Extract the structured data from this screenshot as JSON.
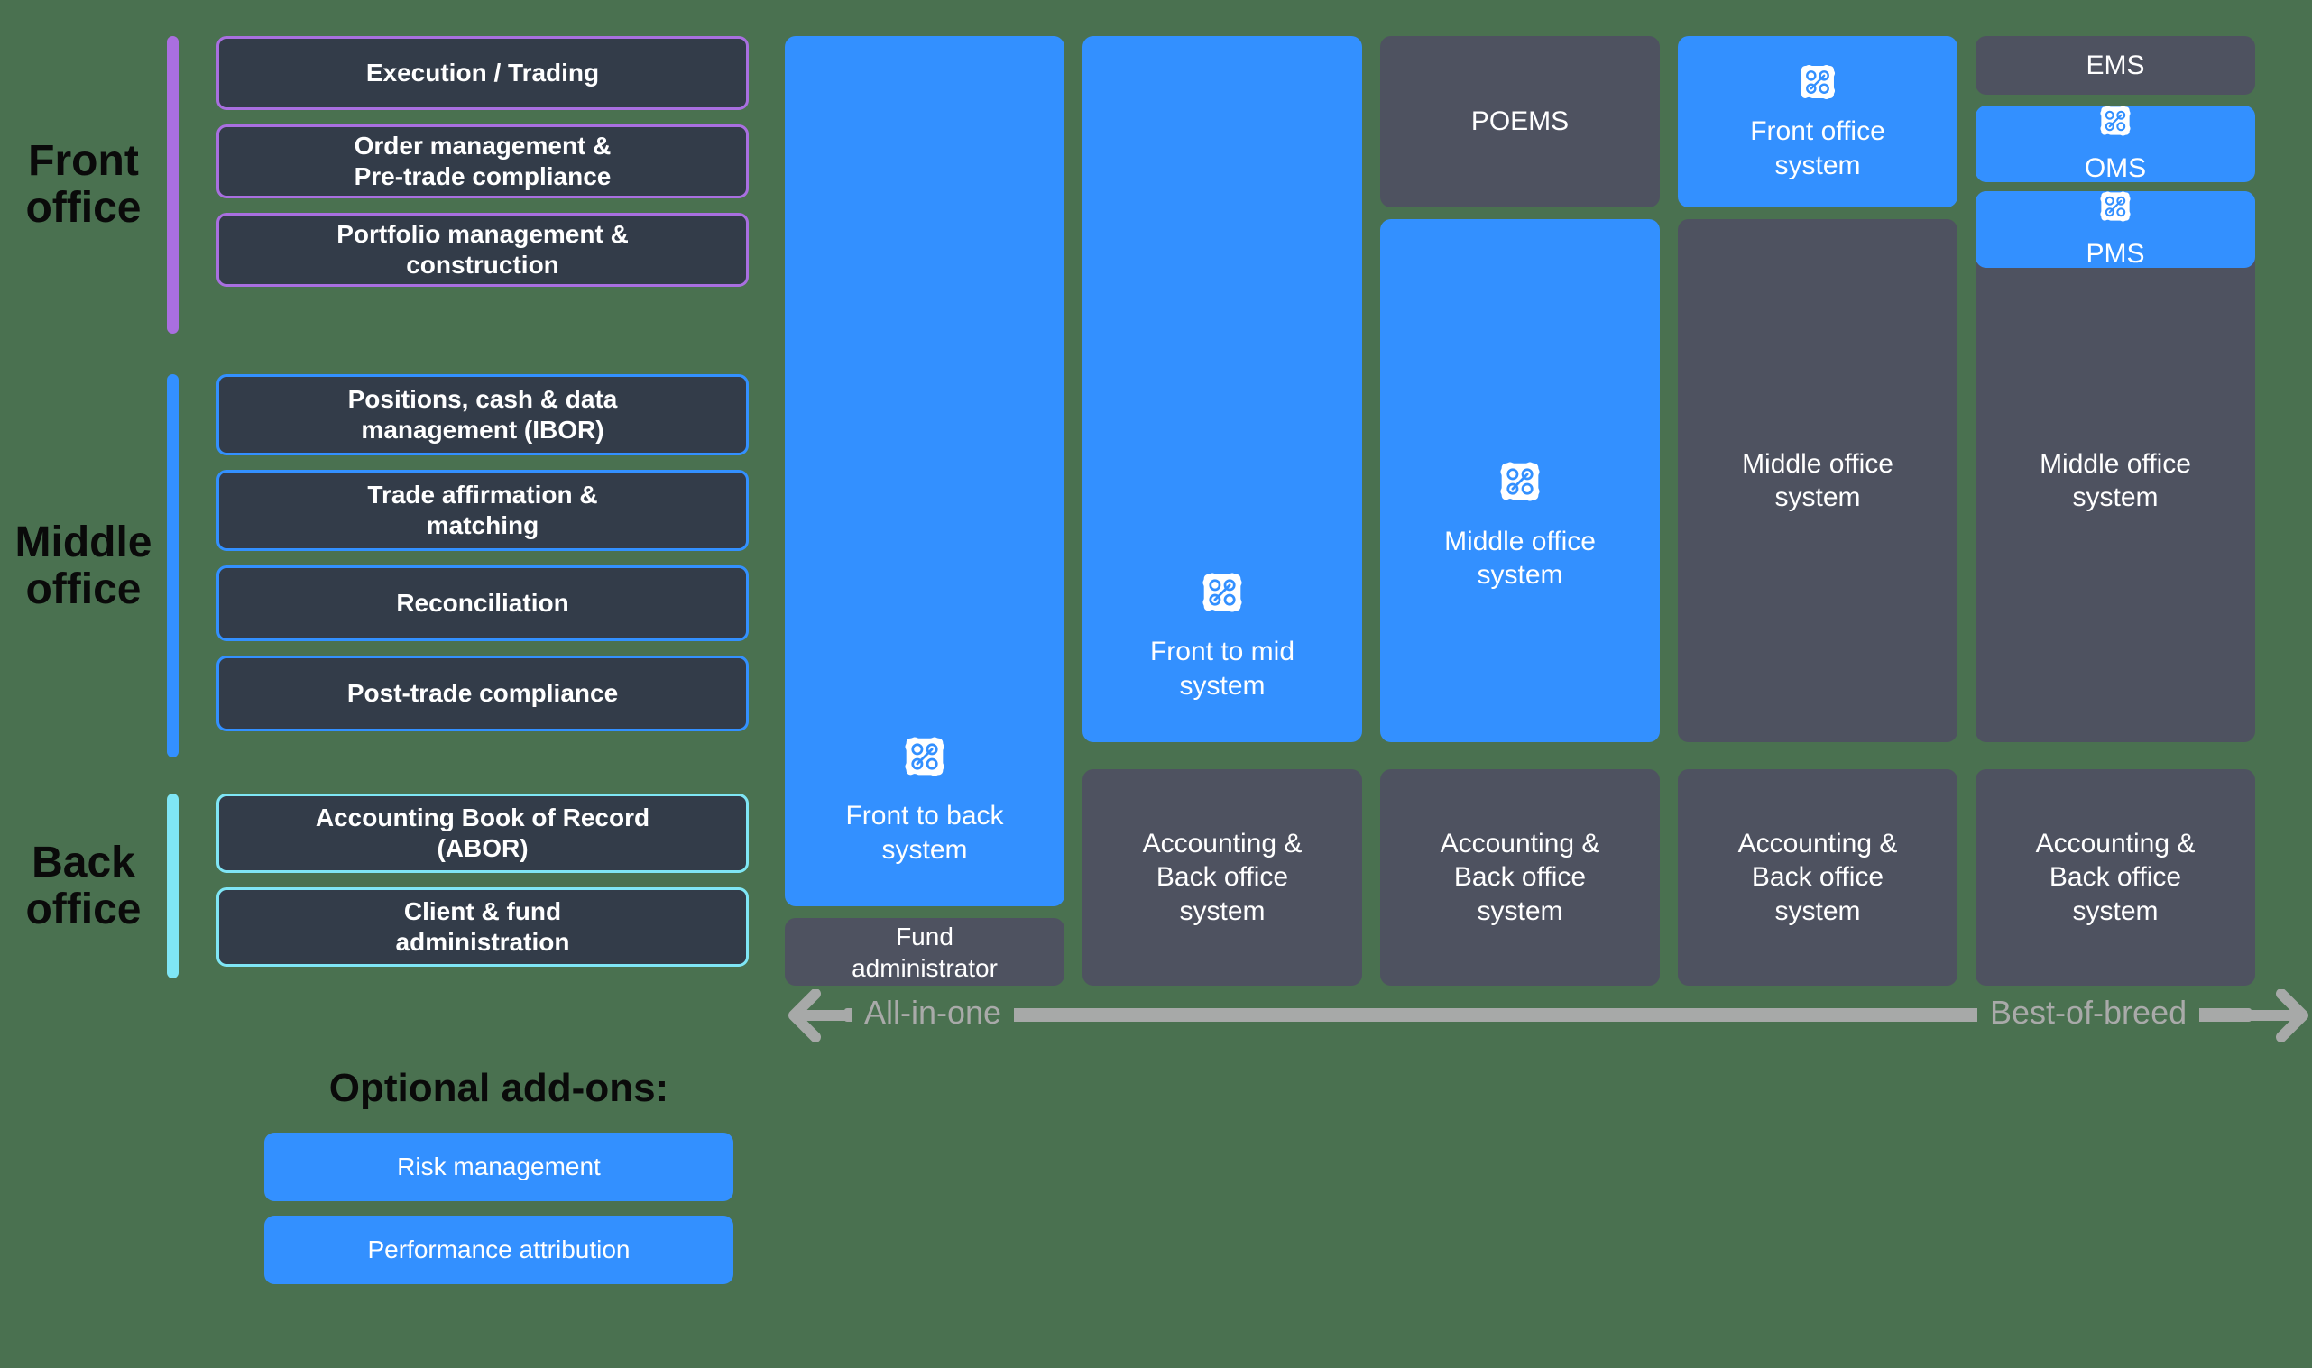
{
  "colors": {
    "background": "#4a7150",
    "blue": "#3390ff",
    "grey_tile": "#4e5260",
    "left_card": "#333c49",
    "front_accent": "#a96fe0",
    "middle_accent": "#3390ff",
    "back_accent": "#7fe6f5",
    "spectrum": "#a7a9a8"
  },
  "left_panel": {
    "sections": [
      {
        "label": "Front\noffice",
        "accent": "#a96fe0",
        "cards": [
          "Execution / Trading",
          "Order management &\nPre-trade compliance",
          "Portfolio management &\nconstruction"
        ]
      },
      {
        "label": "Middle\noffice",
        "accent": "#3390ff",
        "cards": [
          "Positions, cash & data\nmanagement (IBOR)",
          "Trade affirmation &\nmatching",
          "Reconciliation",
          "Post-trade compliance"
        ]
      },
      {
        "label": "Back\noffice",
        "accent": "#7fe6f5",
        "cards": [
          "Accounting Book of Record\n(ABOR)",
          "Client & fund\nadministration"
        ]
      }
    ],
    "addons": {
      "title": "Optional add-ons:",
      "items": [
        "Risk management",
        "Performance attribution"
      ]
    }
  },
  "right_panel": {
    "columns": [
      {
        "name": "all-in-one",
        "tiles": [
          {
            "label": "Front to back\nsystem",
            "style": "blue",
            "icon": "network-nodes-icon"
          },
          {
            "label": "Fund\nadministrator",
            "style": "grey",
            "icon": null
          }
        ]
      },
      {
        "name": "front-to-mid",
        "tiles": [
          {
            "label": "Front to mid\nsystem",
            "style": "blue",
            "icon": "network-nodes-icon"
          },
          {
            "label": "Accounting &\nBack office\nsystem",
            "style": "grey",
            "icon": null
          }
        ]
      },
      {
        "name": "poems",
        "tiles": [
          {
            "label": "POEMS",
            "style": "grey",
            "icon": null
          },
          {
            "label": "Middle office\nsystem",
            "style": "blue",
            "icon": "network-nodes-icon"
          },
          {
            "label": "Accounting &\nBack office\nsystem",
            "style": "grey",
            "icon": null
          }
        ]
      },
      {
        "name": "front-office-system",
        "tiles": [
          {
            "label": "Front office\nsystem",
            "style": "blue",
            "icon": "network-nodes-icon"
          },
          {
            "label": "Middle office\nsystem",
            "style": "grey",
            "icon": null
          },
          {
            "label": "Accounting &\nBack office\nsystem",
            "style": "grey",
            "icon": null
          }
        ]
      },
      {
        "name": "best-of-breed",
        "tiles": [
          {
            "label": "EMS",
            "style": "grey",
            "icon": null
          },
          {
            "label": "OMS",
            "style": "blue",
            "icon": "network-nodes-icon"
          },
          {
            "label": "PMS",
            "style": "blue",
            "icon": "network-nodes-icon"
          },
          {
            "label": "Middle office\nsystem",
            "style": "grey",
            "icon": null
          },
          {
            "label": "Accounting &\nBack office\nsystem",
            "style": "grey",
            "icon": null
          }
        ]
      }
    ],
    "spectrum": {
      "left_label": "All-in-one",
      "right_label": "Best-of-breed",
      "left_icon": "arrow-left-icon",
      "right_icon": "arrow-right-icon"
    }
  }
}
